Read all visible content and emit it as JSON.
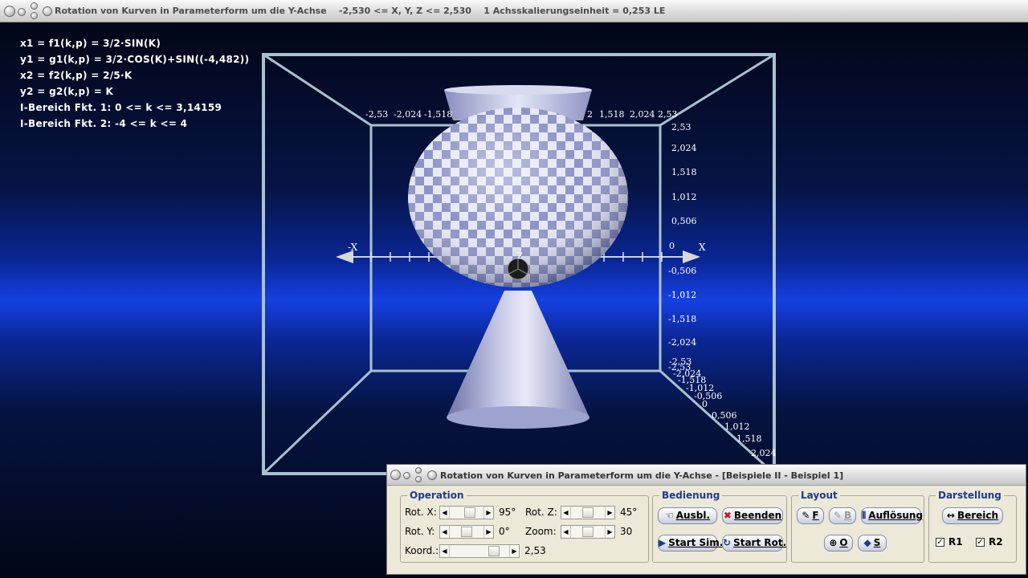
{
  "window": {
    "title": "Rotation von Kurven in Parameterform um die Y-Achse    -2,530 <= X, Y, Z <= 2,530    1 Achsskalierungseinheit = 0,253 LE"
  },
  "formulas": [
    "x1 = f1(k,p) = 3/2·SIN(K)",
    "y1 = g1(k,p) = 3/2·COS(K)+SIN((-4,482))",
    "x2 = f2(k,p) = 2/5·K",
    "y2 = g2(k,p) = K",
    "I-Bereich Fkt. 1: 0 <= k <= 3,14159",
    "I-Bereich Fkt. 2: -4 <= k <= 4"
  ],
  "axes": {
    "x_neg_label": "-X",
    "x_pos_label": "X",
    "z_label": "Z",
    "top_ticks": [
      "-2,53",
      "-2,024",
      "-1,518",
      "1,518",
      "2,024",
      "2,53"
    ],
    "top_tick_partial": "2",
    "right_ticks": [
      "2,53",
      "2,024",
      "1,518",
      "1,012",
      "0,506",
      "0",
      "-0,506",
      "-1,012",
      "-1,518",
      "-2,024",
      "-2,53"
    ],
    "depth_ticks": [
      "-2,53",
      "-2,024",
      "-1,518",
      "-1,012",
      "-0,506",
      "0",
      "0,506",
      "1,012",
      "1,518",
      "2,024"
    ]
  },
  "panel": {
    "title": "Rotation von Kurven in Parameterform um die Y-Achse - [Beispiele II - Beispiel 1]",
    "operation": {
      "label": "Operation",
      "rot_x_label": "Rot. X:",
      "rot_x_value": "95°",
      "rot_y_label": "Rot. Y:",
      "rot_y_value": "0°",
      "rot_z_label": "Rot. Z:",
      "rot_z_value": "45°",
      "zoom_label": "Zoom:",
      "zoom_value": "30",
      "koord_label": "Koord.:",
      "koord_value": "2,53"
    },
    "bedienung": {
      "label": "Bedienung",
      "ausbl": "Ausbl.",
      "beenden": "Beenden",
      "start_sim": "Start Sim.",
      "start_rot": "Start Rot."
    },
    "layout": {
      "label": "Layout",
      "f": "F",
      "b": "B",
      "aufloesung": "Auflösung",
      "o": "O",
      "s": "S"
    },
    "darstellung": {
      "label": "Darstellung",
      "bereich": "Bereich",
      "r1": "R1",
      "r2": "R2",
      "r1_checked": true,
      "r2_checked": true
    }
  }
}
